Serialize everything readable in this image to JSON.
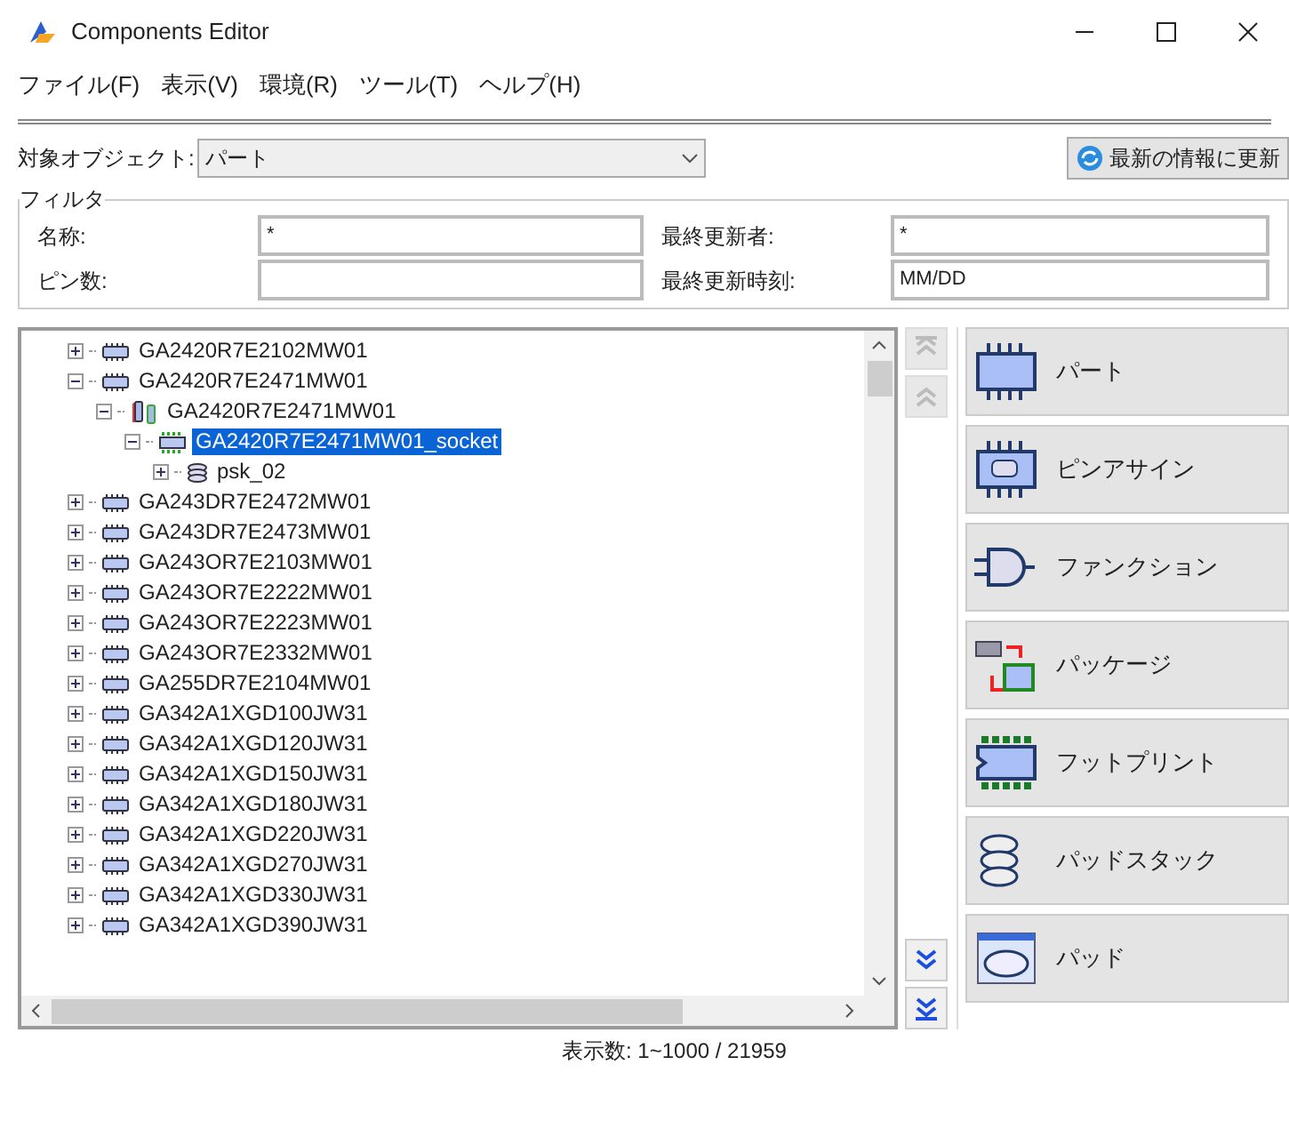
{
  "window": {
    "title": "Components Editor"
  },
  "menu": [
    "ファイル(F)",
    "表示(V)",
    "環境(R)",
    "ツール(T)",
    "ヘルプ(H)"
  ],
  "target": {
    "label": "対象オブジェクト:",
    "value": "パート"
  },
  "refresh_button": "最新の情報に更新",
  "filter": {
    "title": "フィルタ",
    "fields": [
      {
        "label": "名称:",
        "value": "*"
      },
      {
        "label": "最終更新者:",
        "value": "*"
      },
      {
        "label": "ピン数:"
      },
      {
        "label": "最終更新時刻:",
        "value": "MM/DD"
      }
    ]
  },
  "tree": [
    {
      "label": "GA2420R7E2102MW01",
      "kind": "part",
      "expanded": false,
      "selected": false
    },
    {
      "label": "GA2420R7E2471MW01",
      "kind": "part",
      "expanded": true,
      "selected": false,
      "children": [
        {
          "label": "GA2420R7E2471MW01",
          "kind": "package",
          "expanded": true,
          "selected": false,
          "children": [
            {
              "label": "GA2420R7E2471MW01_socket",
              "kind": "footprint",
              "expanded": true,
              "selected": true,
              "children": [
                {
                  "label": "psk_02",
                  "kind": "padstack",
                  "expanded": false,
                  "selected": false
                }
              ]
            }
          ]
        }
      ]
    },
    {
      "label": "GA243DR7E2472MW01",
      "kind": "part",
      "expanded": false,
      "selected": false
    },
    {
      "label": "GA243DR7E2473MW01",
      "kind": "part",
      "expanded": false,
      "selected": false
    },
    {
      "label": "GA243OR7E2103MW01",
      "kind": "part",
      "expanded": false,
      "selected": false
    },
    {
      "label": "GA243OR7E2222MW01",
      "kind": "part",
      "expanded": false,
      "selected": false
    },
    {
      "label": "GA243OR7E2223MW01",
      "kind": "part",
      "expanded": false,
      "selected": false
    },
    {
      "label": "GA243OR7E2332MW01",
      "kind": "part",
      "expanded": false,
      "selected": false
    },
    {
      "label": "GA255DR7E2104MW01",
      "kind": "part",
      "expanded": false,
      "selected": false
    },
    {
      "label": "GA342A1XGD100JW31",
      "kind": "part",
      "expanded": false,
      "selected": false
    },
    {
      "label": "GA342A1XGD120JW31",
      "kind": "part",
      "expanded": false,
      "selected": false
    },
    {
      "label": "GA342A1XGD150JW31",
      "kind": "part",
      "expanded": false,
      "selected": false
    },
    {
      "label": "GA342A1XGD180JW31",
      "kind": "part",
      "expanded": false,
      "selected": false
    },
    {
      "label": "GA342A1XGD220JW31",
      "kind": "part",
      "expanded": false,
      "selected": false
    },
    {
      "label": "GA342A1XGD270JW31",
      "kind": "part",
      "expanded": false,
      "selected": false
    },
    {
      "label": "GA342A1XGD330JW31",
      "kind": "part",
      "expanded": false,
      "selected": false
    },
    {
      "label": "GA342A1XGD390JW31",
      "kind": "part",
      "expanded": false,
      "selected": false
    }
  ],
  "nav_buttons": [
    {
      "kind": "first",
      "disabled": true
    },
    {
      "kind": "prev",
      "disabled": true
    },
    {
      "kind": "next",
      "disabled": false
    },
    {
      "kind": "last",
      "disabled": false
    }
  ],
  "editors": [
    {
      "label": "パート",
      "kind": "part"
    },
    {
      "label": "ピンアサイン",
      "kind": "pinassign"
    },
    {
      "label": "ファンクション",
      "kind": "function"
    },
    {
      "label": "パッケージ",
      "kind": "package"
    },
    {
      "label": "フットプリント",
      "kind": "footprint"
    },
    {
      "label": "パッドスタック",
      "kind": "padstack"
    },
    {
      "label": "パッド",
      "kind": "pad"
    }
  ],
  "status": "表示数: 1~1000 / 21959"
}
